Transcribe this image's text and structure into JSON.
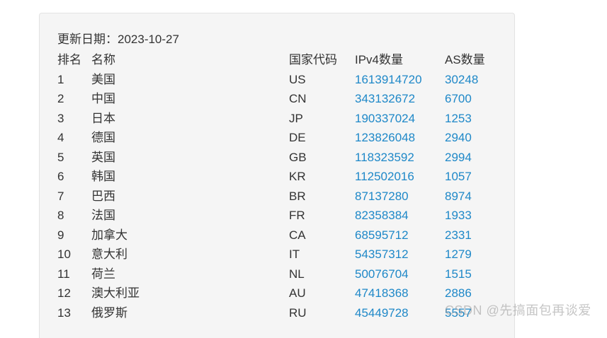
{
  "updated": "更新日期：2023-10-27",
  "headers": {
    "rank": "排名",
    "name": "名称",
    "code": "国家代码",
    "ipv4": "IPv4数量",
    "as": "AS数量"
  },
  "rows": [
    {
      "rank": "1",
      "name": "美国",
      "code": "US",
      "ipv4": "1613914720",
      "as": "30248"
    },
    {
      "rank": "2",
      "name": "中国",
      "code": "CN",
      "ipv4": "343132672",
      "as": "6700"
    },
    {
      "rank": "3",
      "name": "日本",
      "code": "JP",
      "ipv4": "190337024",
      "as": "1253"
    },
    {
      "rank": "4",
      "name": "德国",
      "code": "DE",
      "ipv4": "123826048",
      "as": "2940"
    },
    {
      "rank": "5",
      "name": "英国",
      "code": "GB",
      "ipv4": "118323592",
      "as": "2994"
    },
    {
      "rank": "6",
      "name": "韩国",
      "code": "KR",
      "ipv4": "112502016",
      "as": "1057"
    },
    {
      "rank": "7",
      "name": "巴西",
      "code": "BR",
      "ipv4": "87137280",
      "as": "8974"
    },
    {
      "rank": "8",
      "name": "法国",
      "code": "FR",
      "ipv4": "82358384",
      "as": "1933"
    },
    {
      "rank": "9",
      "name": "加拿大",
      "code": "CA",
      "ipv4": "68595712",
      "as": "2331"
    },
    {
      "rank": "10",
      "name": "意大利",
      "code": "IT",
      "ipv4": "54357312",
      "as": "1279"
    },
    {
      "rank": "11",
      "name": "荷兰",
      "code": "NL",
      "ipv4": "50076704",
      "as": "1515"
    },
    {
      "rank": "12",
      "name": "澳大利亚",
      "code": "AU",
      "ipv4": "47418368",
      "as": "2886"
    },
    {
      "rank": "13",
      "name": "俄罗斯",
      "code": "RU",
      "ipv4": "45449728",
      "as": "5557"
    }
  ],
  "watermark": "CSDN @先搞面包再谈爱",
  "colors": {
    "link": "#1e88c8",
    "panel_bg": "#f5f5f5",
    "text": "#333333"
  }
}
